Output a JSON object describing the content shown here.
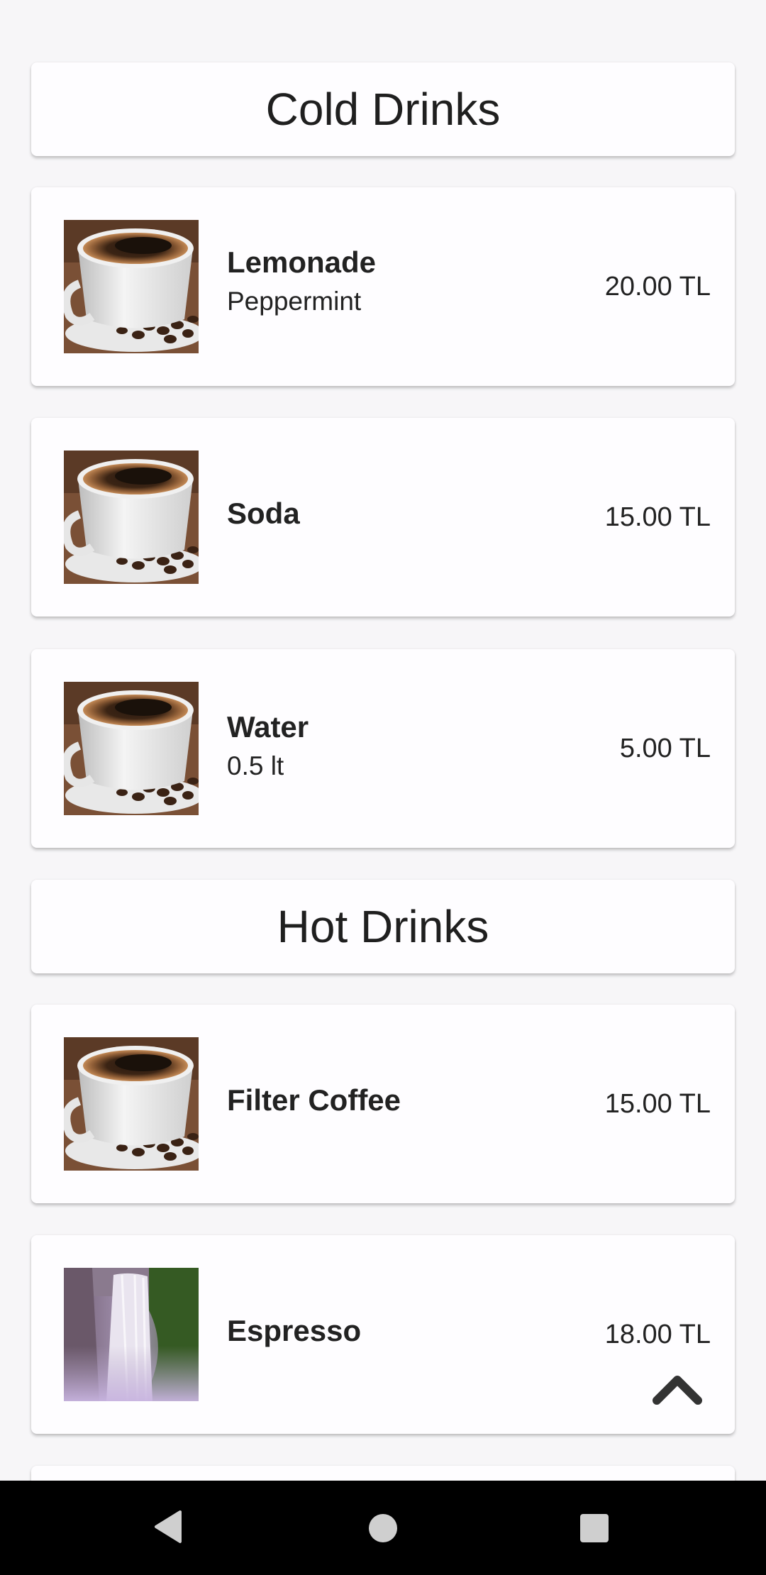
{
  "sections": [
    {
      "title": "Cold Drinks",
      "items": [
        {
          "name": "Lemonade",
          "description": "Peppermint",
          "price": "20.00 TL",
          "image": "coffee-cup-image"
        },
        {
          "name": "Soda",
          "description": "",
          "price": "15.00 TL",
          "image": "coffee-cup-image"
        },
        {
          "name": "Water",
          "description": "0.5 lt",
          "price": "5.00 TL",
          "image": "coffee-cup-image"
        }
      ]
    },
    {
      "title": "Hot Drinks",
      "items": [
        {
          "name": "Filter Coffee",
          "description": "",
          "price": "15.00 TL",
          "image": "coffee-cup-image"
        },
        {
          "name": "Espresso",
          "description": "",
          "price": "18.00 TL",
          "image": "waterfall-image"
        }
      ]
    }
  ],
  "icons": {
    "scroll_up": "chevron-up-icon",
    "nav_back": "back-triangle-icon",
    "nav_home": "home-circle-icon",
    "nav_recents": "recents-square-icon"
  },
  "colors": {
    "background": "#f7f6f8",
    "card": "#fefdff",
    "text": "#222222",
    "navbar": "#000000",
    "icon": "#333333"
  }
}
